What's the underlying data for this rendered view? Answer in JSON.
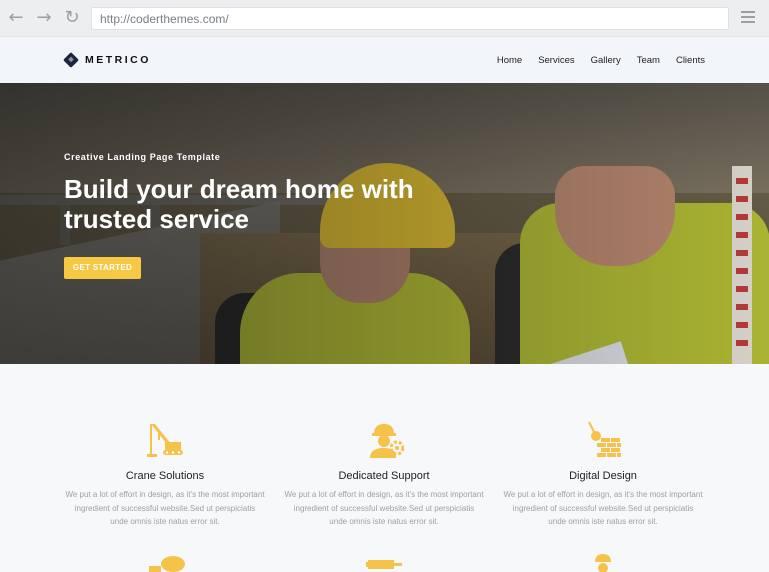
{
  "browser": {
    "url": "http://coderthemes.com/"
  },
  "site": {
    "logo_text": "METRICO",
    "nav": [
      {
        "label": "Home"
      },
      {
        "label": "Services"
      },
      {
        "label": "Gallery"
      },
      {
        "label": "Team"
      },
      {
        "label": "Clients"
      }
    ]
  },
  "hero": {
    "subtitle": "Creative Landing Page Template",
    "title": "Build your dream home with trusted service",
    "cta": "GET STARTED"
  },
  "services": [
    {
      "icon": "crane-icon",
      "title": "Crane Solutions",
      "text": "We put a lot of effort in design, as it's the most important ingredient of successful website.Sed ut perspiciatis unde omnis iste natus error sit."
    },
    {
      "icon": "worker-gear-icon",
      "title": "Dedicated Support",
      "text": "We put a lot of effort in design, as it's the most important ingredient of successful website.Sed ut perspiciatis unde omnis iste natus error sit."
    },
    {
      "icon": "wrecking-ball-icon",
      "title": "Digital Design",
      "text": "We put a lot of effort in design, as it's the most important ingredient of successful website.Sed ut perspiciatis unde omnis iste natus error sit."
    }
  ],
  "colors": {
    "accent": "#f7c843",
    "icon": "#f5c24a",
    "nav_bg": "#f2f5fa"
  }
}
